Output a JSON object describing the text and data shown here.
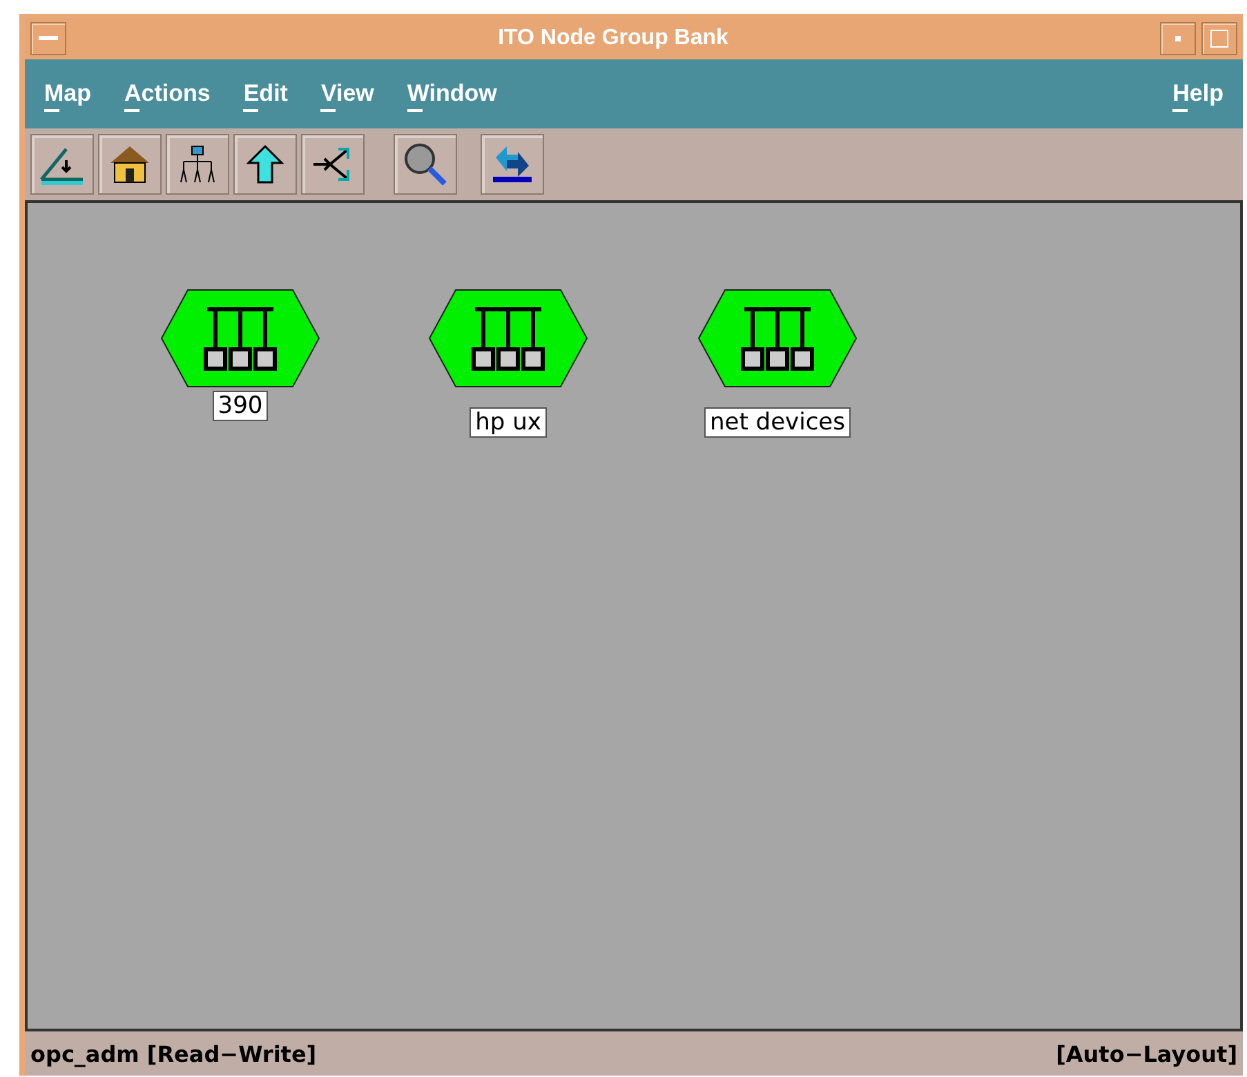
{
  "window": {
    "title": "ITO Node Group Bank"
  },
  "menu": [
    {
      "label": "Map"
    },
    {
      "label": "Actions"
    },
    {
      "label": "Edit"
    },
    {
      "label": "View"
    },
    {
      "label": "Window"
    }
  ],
  "help_menu": {
    "label": "Help"
  },
  "toolbar": [
    {
      "kind": "close-map"
    },
    {
      "kind": "home"
    },
    {
      "kind": "tree"
    },
    {
      "kind": "up"
    },
    {
      "kind": "fork"
    },
    {
      "kind": "search"
    },
    {
      "kind": "logo"
    }
  ],
  "nodes": [
    {
      "label": "390"
    },
    {
      "label": "hp ux"
    },
    {
      "label": "net devices"
    }
  ],
  "status_bar": {
    "left": "opc_adm [Read−Write]",
    "right": "[Auto−Layout]"
  }
}
